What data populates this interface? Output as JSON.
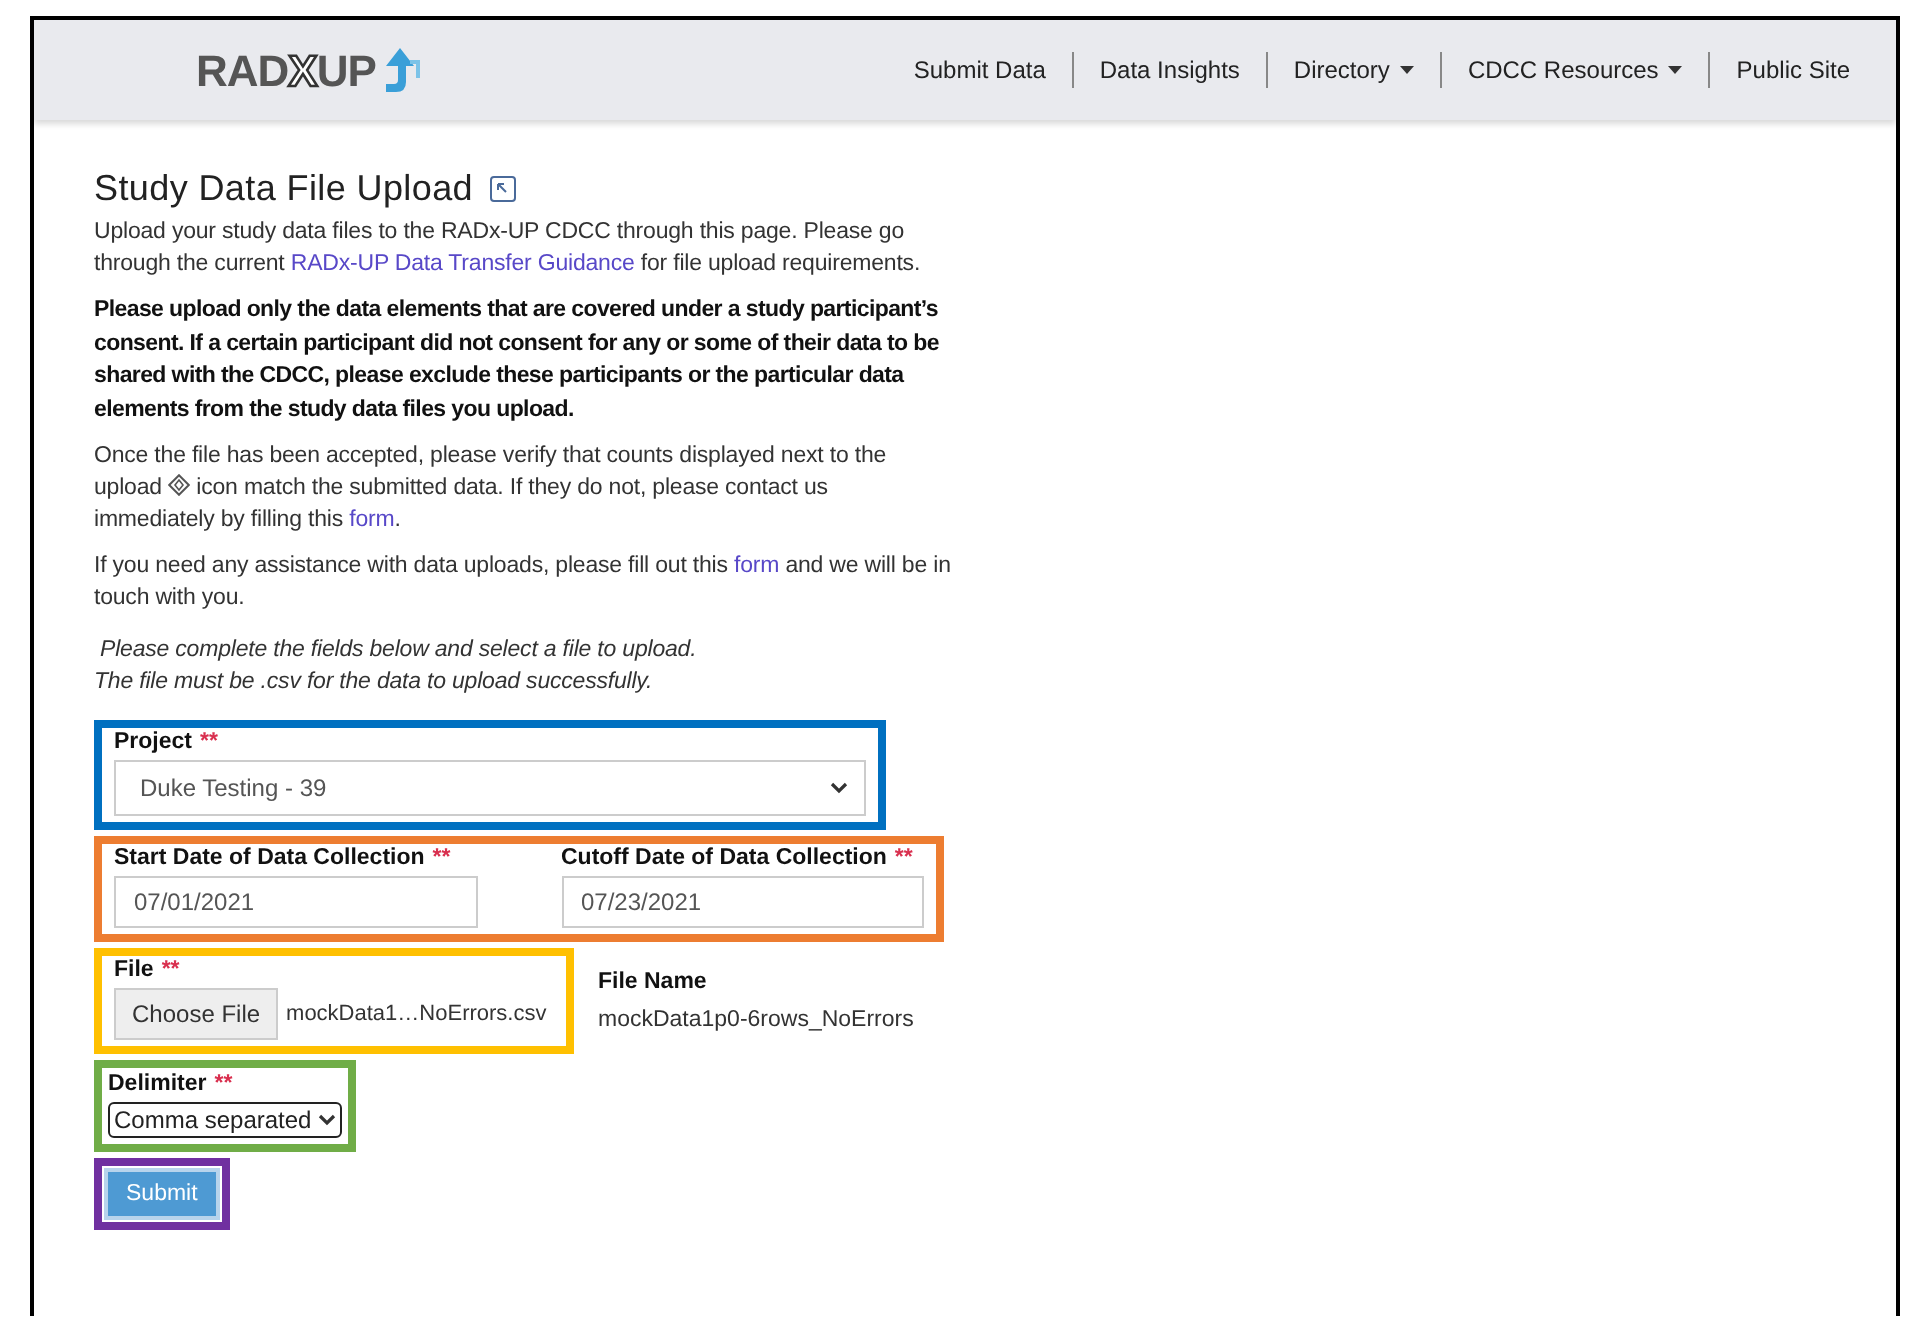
{
  "header": {
    "logo": {
      "parts": [
        {
          "text": "RAD",
          "kind": "solid"
        },
        {
          "text": "X",
          "kind": "outline"
        },
        {
          "text": "UP",
          "kind": "solid"
        }
      ]
    },
    "nav": [
      {
        "label": "Submit Data",
        "dropdown": false
      },
      {
        "label": "Data Insights",
        "dropdown": false
      },
      {
        "label": "Directory",
        "dropdown": true
      },
      {
        "label": "CDCC Resources",
        "dropdown": true
      },
      {
        "label": "Public Site",
        "dropdown": false
      }
    ]
  },
  "page": {
    "title": "Study Data File Upload",
    "paragraphs": [
      {
        "kind": "normal",
        "segments": [
          {
            "kind": "text",
            "text": "Upload your study data files to the RADx-UP CDCC through this page. Please go through the current "
          },
          {
            "kind": "link",
            "text": "RADx-UP Data Transfer Guidance"
          },
          {
            "kind": "text",
            "text": " for file upload requirements."
          }
        ]
      },
      {
        "kind": "bold",
        "segments": [
          {
            "kind": "text",
            "text": "Please upload only the data elements that are covered under a study participant’s consent. If a certain participant did not consent for any or some of their data to be shared with the CDCC, please exclude these participants or the particular data elements from the study data files you upload."
          }
        ]
      },
      {
        "kind": "normal",
        "segments": [
          {
            "kind": "text",
            "text": "Once the file has been accepted, please verify that counts displayed next to the upload"
          },
          {
            "kind": "icon"
          },
          {
            "kind": "text",
            "text": "icon match the submitted data. If they do not, please contact us immediately by filling this "
          },
          {
            "kind": "link",
            "text": "form"
          },
          {
            "kind": "text",
            "text": "."
          }
        ]
      },
      {
        "kind": "normal",
        "segments": [
          {
            "kind": "text",
            "text": "If you need any assistance with data uploads, please fill out this "
          },
          {
            "kind": "link",
            "text": "form"
          },
          {
            "kind": "text",
            "text": " and we will be in touch with you."
          }
        ]
      },
      {
        "kind": "italic",
        "segments": [
          {
            "kind": "text",
            "text": "Please complete the fields below and select a file to upload."
          }
        ]
      },
      {
        "kind": "italic",
        "segments": [
          {
            "kind": "text",
            "text": "The file must be .csv for the data to upload successfully."
          }
        ]
      }
    ],
    "form": [
      {
        "kind": "select-wide",
        "color": "#0070c0",
        "fields": [
          {
            "label": "Project",
            "required": "**",
            "value": "Duke Testing - 39"
          }
        ]
      },
      {
        "kind": "dates",
        "color": "#ed7d31",
        "fields": [
          {
            "label": "Start Date of Data Collection",
            "required": "**",
            "value": "07/01/2021"
          },
          {
            "label": "Cutoff Date of Data Collection",
            "required": "**",
            "value": "07/23/2021"
          }
        ]
      },
      {
        "kind": "file",
        "color": "#ffc000",
        "fields": [
          {
            "label": "File",
            "required": "**",
            "button": "Choose File",
            "value": "mockData1…NoErrors.csv"
          }
        ],
        "aside": {
          "label": "File Name",
          "value": "mockData1p0-6rows_NoErrors"
        }
      },
      {
        "kind": "select-small",
        "color": "#70ad47",
        "fields": [
          {
            "label": "Delimiter",
            "required": "**",
            "value": "Comma separated"
          }
        ]
      },
      {
        "kind": "submit",
        "color": "#7030a0",
        "fields": [
          {
            "button": "Submit"
          }
        ]
      }
    ]
  }
}
